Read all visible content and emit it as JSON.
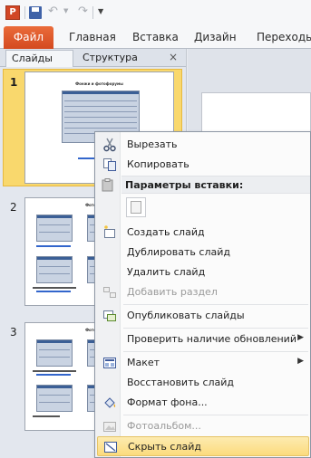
{
  "qat": {
    "app_icon": "P"
  },
  "tabs": [
    "Файл",
    "Главная",
    "Вставка",
    "Дизайн",
    "Переходы"
  ],
  "pane": {
    "tabs": [
      "Слайды",
      "Структура"
    ],
    "close": "×"
  },
  "slides": [
    {
      "number": "1",
      "title": "Фонжи и фотофорумы"
    },
    {
      "number": "2",
      "title": "Фотофорумы"
    },
    {
      "number": "3",
      "title": "Фотофорумы"
    }
  ],
  "menu": {
    "cut": "Вырезать",
    "copy": "Копировать",
    "paste_options": "Параметры вставки:",
    "new_slide": "Создать слайд",
    "duplicate_slide": "Дублировать слайд",
    "delete_slide": "Удалить слайд",
    "add_section": "Добавить раздел",
    "publish_slides": "Опубликовать слайды",
    "check_updates": "Проверить наличие обновлений",
    "layout": "Макет",
    "reset_slide": "Восстановить слайд",
    "background_format": "Формат фона...",
    "photo_album": "Фотоальбом...",
    "hide_slide": "Скрыть слайд"
  },
  "icons": [
    "app-icon",
    "save-icon",
    "undo-icon",
    "redo-icon",
    "customize-qat-icon",
    "close-icon",
    "scissors-icon",
    "copy-icon",
    "paste-icon",
    "new-slide-icon",
    "section-icon",
    "publish-icon",
    "layout-icon",
    "fill-bucket-icon",
    "photo-album-icon",
    "hide-slide-icon"
  ],
  "colors": {
    "file_tab": "#e35a2e",
    "selection": "#f9d86d",
    "menu_highlight": "#fbdb7d"
  }
}
